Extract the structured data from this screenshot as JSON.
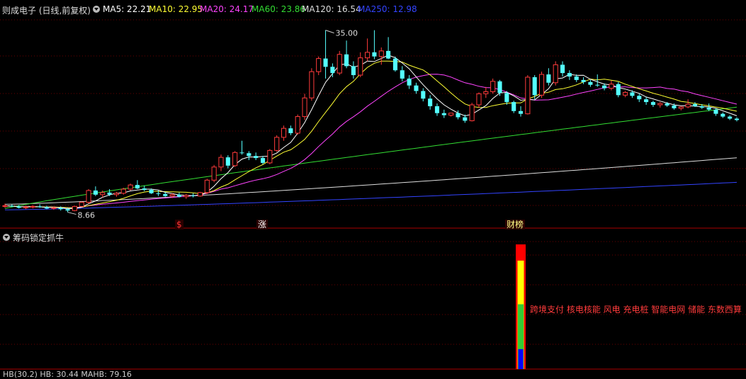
{
  "header": {
    "stock_label": "则成电子 (日线,前复权)",
    "ma": [
      {
        "label": "MA5: 22.21",
        "color": "#ffffff"
      },
      {
        "label": "MA10: 22.95",
        "color": "#ffff33"
      },
      {
        "label": "MA20: 24.17",
        "color": "#ff44ff"
      },
      {
        "label": "MA60: 23.86",
        "color": "#33dd33"
      },
      {
        "label": "MA120: 16.54",
        "color": "#dddddd"
      },
      {
        "label": "MA250: 12.98",
        "color": "#3344ff"
      }
    ]
  },
  "chart_data": {
    "type": "candlestick",
    "high_label": "35.00",
    "low_label": "8.66",
    "candles": [
      [
        9.5,
        9.9,
        9.3,
        9.6
      ],
      [
        9.6,
        9.8,
        9.4,
        9.5
      ],
      [
        9.5,
        9.7,
        9.2,
        9.3
      ],
      [
        9.3,
        9.6,
        9.1,
        9.4
      ],
      [
        9.4,
        9.7,
        9.2,
        9.5
      ],
      [
        9.5,
        9.8,
        9.3,
        9.4
      ],
      [
        9.4,
        9.6,
        9.1,
        9.2
      ],
      [
        9.2,
        9.5,
        9.0,
        9.3
      ],
      [
        9.3,
        9.5,
        8.9,
        9.1
      ],
      [
        9.1,
        9.3,
        8.66,
        8.9
      ],
      [
        8.9,
        9.6,
        8.8,
        9.5
      ],
      [
        9.5,
        10.2,
        9.4,
        10.1
      ],
      [
        10.1,
        12.0,
        9.9,
        11.8
      ],
      [
        11.8,
        12.4,
        11.0,
        11.2
      ],
      [
        11.2,
        11.8,
        10.8,
        11.5
      ],
      [
        11.5,
        12.0,
        11.0,
        11.2
      ],
      [
        11.2,
        11.6,
        10.9,
        11.4
      ],
      [
        11.4,
        12.2,
        11.2,
        12.0
      ],
      [
        12.0,
        12.8,
        11.8,
        12.6
      ],
      [
        12.6,
        13.3,
        12.0,
        12.1
      ],
      [
        12.1,
        12.5,
        11.7,
        11.9
      ],
      [
        11.9,
        12.1,
        11.3,
        11.4
      ],
      [
        11.4,
        11.8,
        11.0,
        11.3
      ],
      [
        11.3,
        11.6,
        10.9,
        11.0
      ],
      [
        11.0,
        11.4,
        10.7,
        11.2
      ],
      [
        11.2,
        11.5,
        10.8,
        10.9
      ],
      [
        10.9,
        11.3,
        10.6,
        11.1
      ],
      [
        11.1,
        11.4,
        10.8,
        11.0
      ],
      [
        11.0,
        11.6,
        10.9,
        11.5
      ],
      [
        11.5,
        13.5,
        11.3,
        13.3
      ],
      [
        13.3,
        15.5,
        13.0,
        15.2
      ],
      [
        15.2,
        17.0,
        14.6,
        16.6
      ],
      [
        16.6,
        16.9,
        15.0,
        15.4
      ],
      [
        15.4,
        17.5,
        15.2,
        17.3
      ],
      [
        17.3,
        19.0,
        17.0,
        17.2
      ],
      [
        17.2,
        17.5,
        16.2,
        16.8
      ],
      [
        16.8,
        17.3,
        16.2,
        16.5
      ],
      [
        16.5,
        16.8,
        15.6,
        15.8
      ],
      [
        15.8,
        17.8,
        15.6,
        17.6
      ],
      [
        17.6,
        19.8,
        17.4,
        19.5
      ],
      [
        19.5,
        21.2,
        19.0,
        20.8
      ],
      [
        20.8,
        21.2,
        19.8,
        20.1
      ],
      [
        20.1,
        22.8,
        19.9,
        22.5
      ],
      [
        22.5,
        25.8,
        22.0,
        25.2
      ],
      [
        25.2,
        29.5,
        24.8,
        29.0
      ],
      [
        29.0,
        31.2,
        28.5,
        30.9
      ],
      [
        30.9,
        35.0,
        28.0,
        29.7
      ],
      [
        29.7,
        30.2,
        28.2,
        28.8
      ],
      [
        28.8,
        32.0,
        28.5,
        31.5
      ],
      [
        31.5,
        33.5,
        29.5,
        29.8
      ],
      [
        29.8,
        30.5,
        28.0,
        28.5
      ],
      [
        28.5,
        31.8,
        28.2,
        31.0
      ],
      [
        31.0,
        33.8,
        30.5,
        31.8
      ],
      [
        31.8,
        35.0,
        30.8,
        31.2
      ],
      [
        31.2,
        32.5,
        30.0,
        32.0
      ],
      [
        32.0,
        34.0,
        30.8,
        30.9
      ],
      [
        30.9,
        31.2,
        29.0,
        29.2
      ],
      [
        29.2,
        29.8,
        27.6,
        28.0
      ],
      [
        28.0,
        28.5,
        26.5,
        27.0
      ],
      [
        27.0,
        27.4,
        25.8,
        26.2
      ],
      [
        26.2,
        26.6,
        24.7,
        25.1
      ],
      [
        25.1,
        25.6,
        23.5,
        24.0
      ],
      [
        24.0,
        24.4,
        22.6,
        23.0
      ],
      [
        23.0,
        23.5,
        22.3,
        22.7
      ],
      [
        22.7,
        23.0,
        22.5,
        23.0
      ],
      [
        23.0,
        23.4,
        22.1,
        22.4
      ],
      [
        22.4,
        22.8,
        21.6,
        21.9
      ],
      [
        21.9,
        24.5,
        21.8,
        24.2
      ],
      [
        24.2,
        26.0,
        23.8,
        25.8
      ],
      [
        25.8,
        26.8,
        25.2,
        26.1
      ],
      [
        26.1,
        28.0,
        25.8,
        27.6
      ],
      [
        27.6,
        27.8,
        25.5,
        25.9
      ],
      [
        25.9,
        26.2,
        24.2,
        24.6
      ],
      [
        24.6,
        24.8,
        23.0,
        23.3
      ],
      [
        23.3,
        24.0,
        22.5,
        22.9
      ],
      [
        22.9,
        28.5,
        22.8,
        28.2
      ],
      [
        28.2,
        28.5,
        25.0,
        25.6
      ],
      [
        25.6,
        29.0,
        25.2,
        28.6
      ],
      [
        28.6,
        29.5,
        27.0,
        27.4
      ],
      [
        27.4,
        30.5,
        27.0,
        30.0
      ],
      [
        30.0,
        30.5,
        28.3,
        28.8
      ],
      [
        28.8,
        29.2,
        27.8,
        28.3
      ],
      [
        28.3,
        28.6,
        27.5,
        27.8
      ],
      [
        27.8,
        28.2,
        27.2,
        27.5
      ],
      [
        27.5,
        27.8,
        26.8,
        27.1
      ],
      [
        27.1,
        28.6,
        26.8,
        27.0
      ],
      [
        27.0,
        27.3,
        26.3,
        26.6
      ],
      [
        26.6,
        27.7,
        26.3,
        27.2
      ],
      [
        27.2,
        27.5,
        25.3,
        25.6
      ],
      [
        25.6,
        26.2,
        25.3,
        26.0
      ],
      [
        26.0,
        26.3,
        25.2,
        25.5
      ],
      [
        25.5,
        25.8,
        24.6,
        25.0
      ],
      [
        25.0,
        25.3,
        24.2,
        24.6
      ],
      [
        24.6,
        24.8,
        23.9,
        24.2
      ],
      [
        24.2,
        24.6,
        23.8,
        24.4
      ],
      [
        24.4,
        24.6,
        23.9,
        24.1
      ],
      [
        24.1,
        24.4,
        23.5,
        23.7
      ],
      [
        23.7,
        24.0,
        23.4,
        23.9
      ],
      [
        23.9,
        25.0,
        23.7,
        24.3
      ],
      [
        24.3,
        24.6,
        23.9,
        24.0
      ],
      [
        24.0,
        24.3,
        23.6,
        23.8
      ],
      [
        23.8,
        24.4,
        23.3,
        23.5
      ],
      [
        23.5,
        23.7,
        22.6,
        22.9
      ],
      [
        22.9,
        23.1,
        22.3,
        22.5
      ],
      [
        22.5,
        22.7,
        22.0,
        22.2
      ],
      [
        22.2,
        22.4,
        21.8,
        22.0
      ]
    ],
    "ma_current": {
      "MA5": 22.21,
      "MA10": 22.95,
      "MA20": 24.17,
      "MA60": 23.86,
      "MA120": 16.54,
      "MA250": 12.98
    },
    "ylim": [
      8.0,
      36.5
    ]
  },
  "news_markers": [
    {
      "label": "$",
      "color": "#ff3333"
    },
    {
      "label": "涨",
      "color": "#ffffff"
    },
    {
      "label": "财榜",
      "color": "#ffff88"
    }
  ],
  "indicator": {
    "title": "筹码锁定抓牛",
    "tags": "跨境支付 核电核能 风电 充电桩 智能电网 储能 东数西算",
    "bottom_text": "HB(30.2) HB: 30.44 MAHB: 79.16",
    "bar_segments": [
      {
        "color": "#ff0000",
        "from": 0,
        "to": 1.0
      },
      {
        "color": "#ffff00",
        "from": 0,
        "to": 0.87
      },
      {
        "color": "#33cc33",
        "from": 0,
        "to": 0.52
      },
      {
        "color": "#0000ff",
        "from": 0,
        "to": 0.16
      }
    ]
  }
}
